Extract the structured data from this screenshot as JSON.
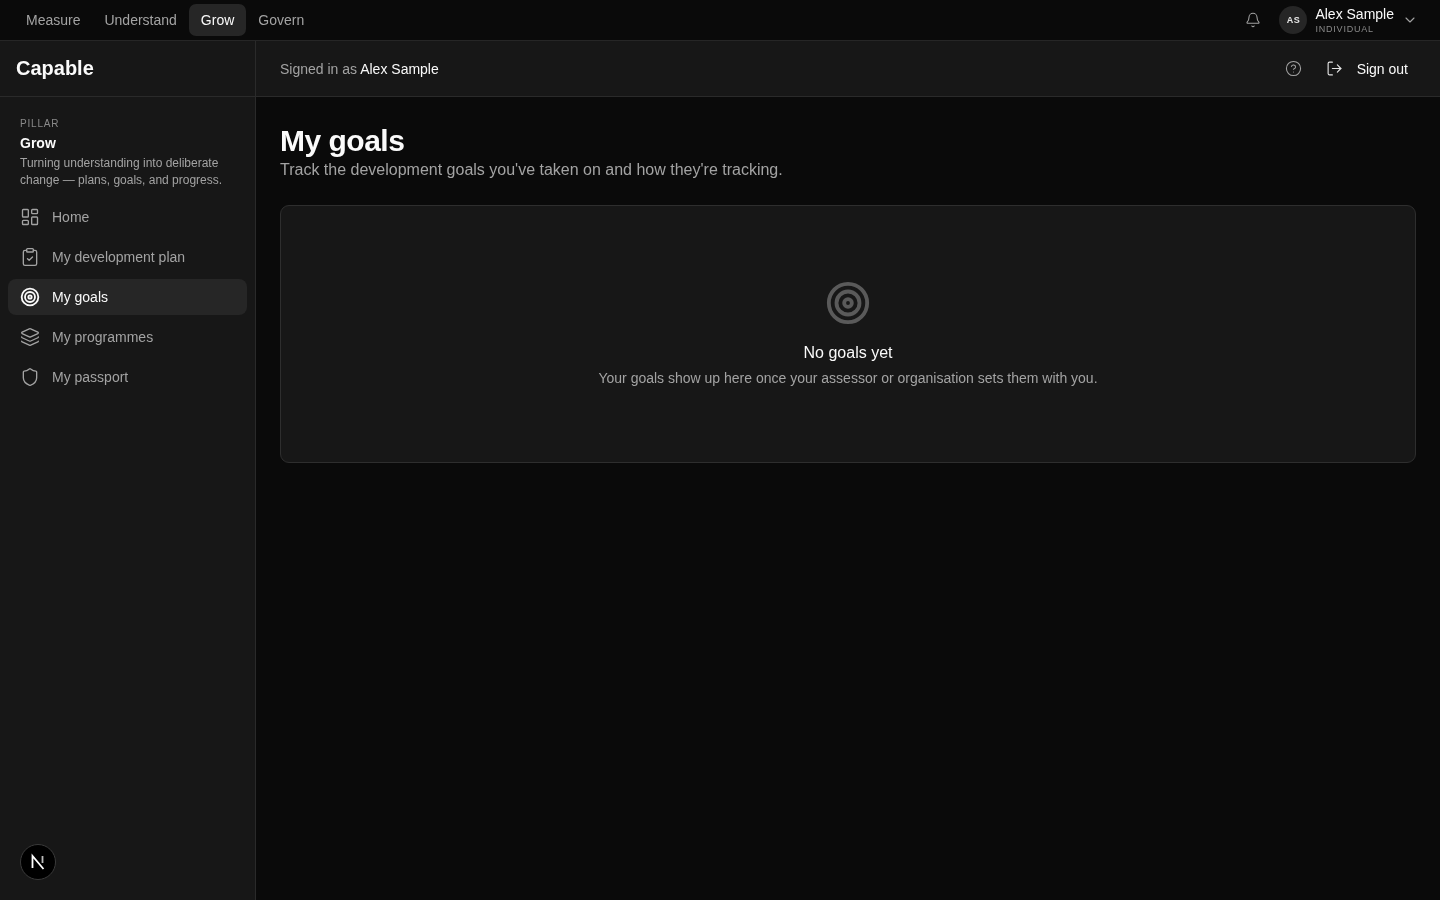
{
  "top_nav": {
    "tabs": [
      {
        "label": "Measure",
        "selected": false
      },
      {
        "label": "Understand",
        "selected": false
      },
      {
        "label": "Grow",
        "selected": true
      },
      {
        "label": "Govern",
        "selected": false
      }
    ]
  },
  "account": {
    "initials": "AS",
    "name": "Alex Sample",
    "role": "INDIVIDUAL"
  },
  "sidebar": {
    "brand": "Capable",
    "pillar": {
      "label": "PILLAR",
      "name": "Grow",
      "description": "Turning understanding into deliberate change — plans, goals, and progress."
    },
    "items": [
      {
        "label": "Home",
        "selected": false
      },
      {
        "label": "My development plan",
        "selected": false
      },
      {
        "label": "My goals",
        "selected": true
      },
      {
        "label": "My programmes",
        "selected": false
      },
      {
        "label": "My passport",
        "selected": false
      }
    ]
  },
  "header": {
    "signed_in": "Signed in as **Alex Sample**",
    "sign_out": "Sign out"
  },
  "page": {
    "title": "My goals",
    "subtitle": "Track the development goals you've taken on and how they're tracking."
  },
  "empty_state": {
    "title": "No goals yet",
    "message": "Your goals show up here once your assessor or organisation sets them with you."
  }
}
